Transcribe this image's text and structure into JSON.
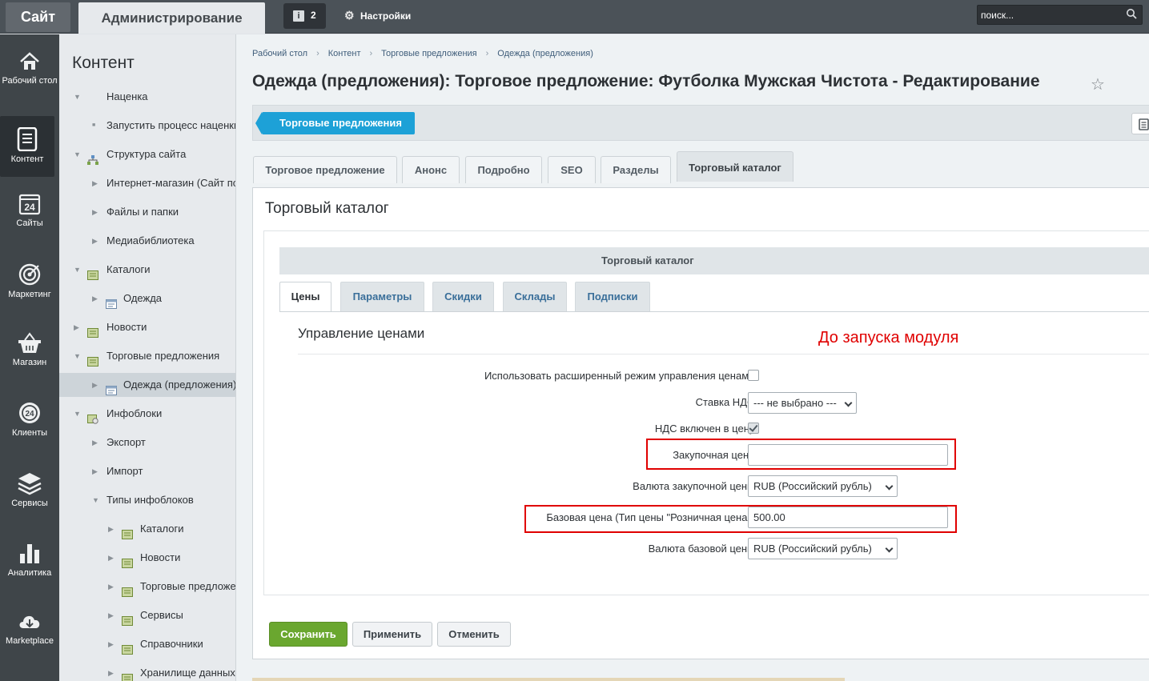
{
  "topbar": {
    "site_label": "Сайт",
    "admin_label": "Администрирование",
    "notifications_count": "2",
    "settings_label": "Настройки",
    "search_placeholder": "поиск..."
  },
  "leftbar": {
    "items": [
      {
        "label": "Рабочий стол",
        "icon": "home-icon"
      },
      {
        "label": "Контент",
        "icon": "document-icon",
        "active": true
      },
      {
        "label": "Сайты",
        "icon": "calendar-24-icon"
      },
      {
        "label": "Маркетинг",
        "icon": "target-icon"
      },
      {
        "label": "Магазин",
        "icon": "basket-icon"
      },
      {
        "label": "Клиенты",
        "icon": "clients-24-icon"
      },
      {
        "label": "Сервисы",
        "icon": "layers-icon"
      },
      {
        "label": "Аналитика",
        "icon": "bar-chart-icon"
      },
      {
        "label": "Marketplace",
        "icon": "cloud-download-icon"
      }
    ]
  },
  "tree": {
    "title": "Контент",
    "items": [
      {
        "label": "Наценка"
      },
      {
        "label": "Запустить процесс наценки"
      },
      {
        "label": "Структура сайта"
      },
      {
        "label": "Интернет-магазин (Сайт по умолчанию)"
      },
      {
        "label": "Файлы и папки"
      },
      {
        "label": "Медиабиблиотека"
      },
      {
        "label": "Каталоги"
      },
      {
        "label": "Одежда"
      },
      {
        "label": "Новости"
      },
      {
        "label": "Торговые предложения"
      },
      {
        "label": "Одежда (предложения)",
        "selected": true
      },
      {
        "label": "Инфоблоки"
      },
      {
        "label": "Экспорт"
      },
      {
        "label": "Импорт"
      },
      {
        "label": "Типы инфоблоков"
      },
      {
        "label": "Каталоги"
      },
      {
        "label": "Новости"
      },
      {
        "label": "Торговые предложения"
      },
      {
        "label": "Сервисы"
      },
      {
        "label": "Справочники"
      },
      {
        "label": "Хранилище данных"
      }
    ]
  },
  "breadcrumbs": [
    "Рабочий стол",
    "Контент",
    "Торговые предложения",
    "Одежда (предложения)"
  ],
  "page_title": "Одежда (предложения): Торговое предложение: Футболка Мужская Чистота - Редактирование",
  "offers_button": "Торговые предложения",
  "tabs": [
    "Торговое предложение",
    "Анонс",
    "Подробно",
    "SEO",
    "Разделы",
    "Торговый каталог"
  ],
  "active_tab": "Торговый каталог",
  "panel": {
    "title": "Торговый каталог",
    "inner_header": "Торговый каталог",
    "subtabs": [
      "Цены",
      "Параметры",
      "Скидки",
      "Склады",
      "Подписки"
    ],
    "active_subtab": "Цены",
    "section_title": "Управление ценами",
    "annotation": "До запуска модуля",
    "annotation_color": "#e00000"
  },
  "form": {
    "advanced_mode_label": "Использовать расширенный режим управления ценами:",
    "advanced_mode_checked": false,
    "vat_rate_label": "Ставка НДС:",
    "vat_rate_value": "--- не выбрано ---",
    "vat_included_label": "НДС включен в цену:",
    "vat_included_checked": true,
    "purchase_price_label": "Закупочная цена:",
    "purchase_price_value": "",
    "purchase_currency_label": "Валюта закупочной цены:",
    "purchase_currency_value": "RUB (Российский рубль)",
    "base_price_label": "Базовая цена (Тип цены \"Розничная цена\"):",
    "base_price_value": "500.00",
    "base_currency_label": "Валюта базовой цены:",
    "base_currency_value": "RUB (Российский рубль)"
  },
  "buttons": {
    "save": "Сохранить",
    "apply": "Применить",
    "cancel": "Отменить"
  },
  "colors": {
    "accent_blue": "#1da1d7",
    "save_green": "#6aa72f",
    "highlight_red": "#e00000"
  }
}
